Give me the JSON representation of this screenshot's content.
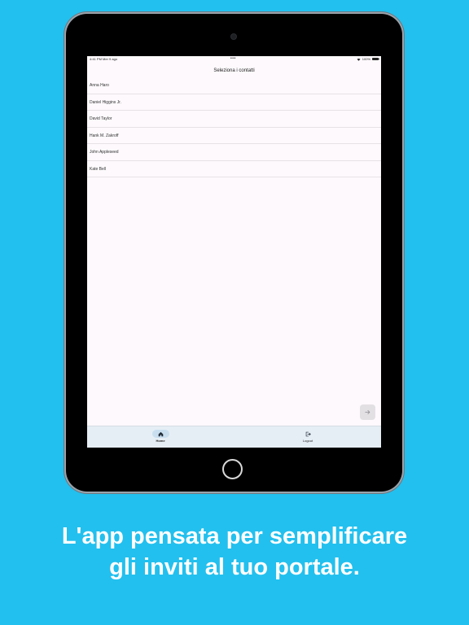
{
  "status_bar": {
    "time": "4:41 PM",
    "date": "Mer 9 ago",
    "dots": "•••",
    "battery": "100%"
  },
  "screen": {
    "title": "Seleziona i contatti",
    "contacts": [
      "Anna Haro",
      "Daniel Higgins Jr.",
      "David Taylor",
      "Hank M. Zakroff",
      "John Appleseed",
      "Kate Bell"
    ]
  },
  "next_button": {
    "icon": "arrow-right-icon"
  },
  "tab_bar": {
    "home": {
      "label": "Home",
      "icon": "home-icon"
    },
    "logout": {
      "label": "Logout",
      "icon": "logout-icon"
    }
  },
  "caption": {
    "line1": "L'app pensata per semplificare",
    "line2": "gli inviti al tuo portale."
  },
  "colors": {
    "background": "#22c0ee",
    "tab_bar": "#e6eef5",
    "active_tab_pill": "#c9dff0"
  }
}
